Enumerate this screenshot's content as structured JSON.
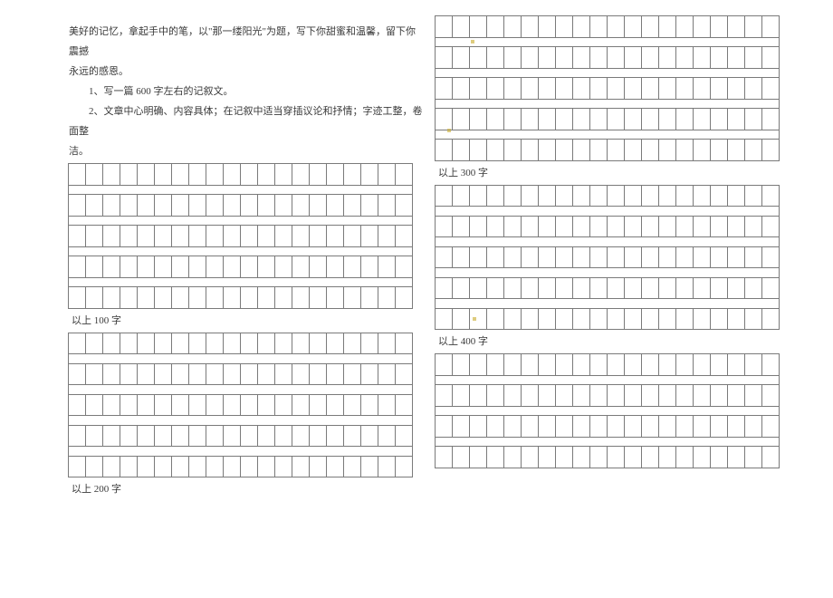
{
  "instructions": {
    "p1": "美好的记忆，拿起手中的笔，以\"那一缕阳光\"为题，写下你甜蜜和温馨，留下你震撼",
    "p1b": "永远的感恩。",
    "p2": "1、写一篇 600 字左右的记叙文。",
    "p3": "2、文章中心明确、内容具体；在记叙中适当穿插议论和抒情；字迹工整，卷面整",
    "p3b": "洁。"
  },
  "labels": {
    "l100": "以上 100 字",
    "l200": "以上 200 字",
    "l300": "以上 300 字",
    "l400": "以上 400 字"
  },
  "grid": {
    "cols": 20,
    "rows_per_block": 5
  }
}
